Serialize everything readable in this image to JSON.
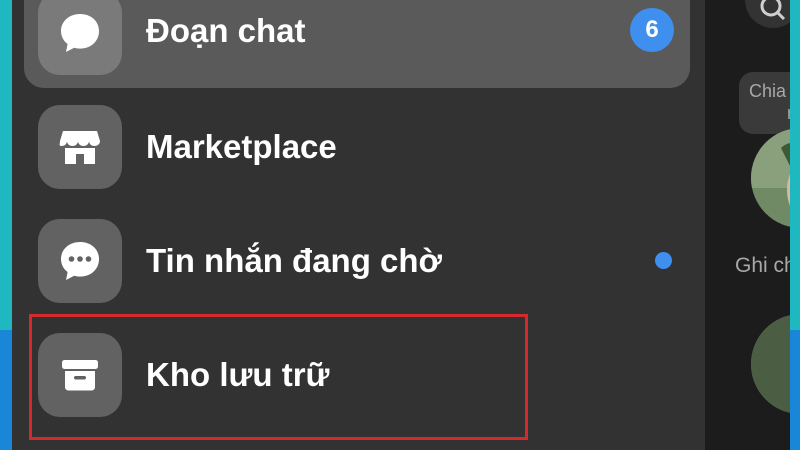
{
  "menu": {
    "items": [
      {
        "label": "Đoạn chat",
        "icon": "chat-bubble-icon",
        "badge": "6",
        "active": true
      },
      {
        "label": "Marketplace",
        "icon": "storefront-icon"
      },
      {
        "label": "Tin nhắn đang chờ",
        "icon": "pending-message-icon",
        "unread_dot": true
      },
      {
        "label": "Kho lưu trữ",
        "icon": "archive-box-icon",
        "highlighted": true
      }
    ]
  },
  "side_panel": {
    "note_bubble_text_line1": "Chia",
    "note_bubble_text_line2": "ng",
    "note_label": "Ghi ch"
  },
  "colors": {
    "accent_blue": "#3f8fef",
    "highlight_red": "#d42a2e",
    "drawer_bg": "#323232"
  }
}
